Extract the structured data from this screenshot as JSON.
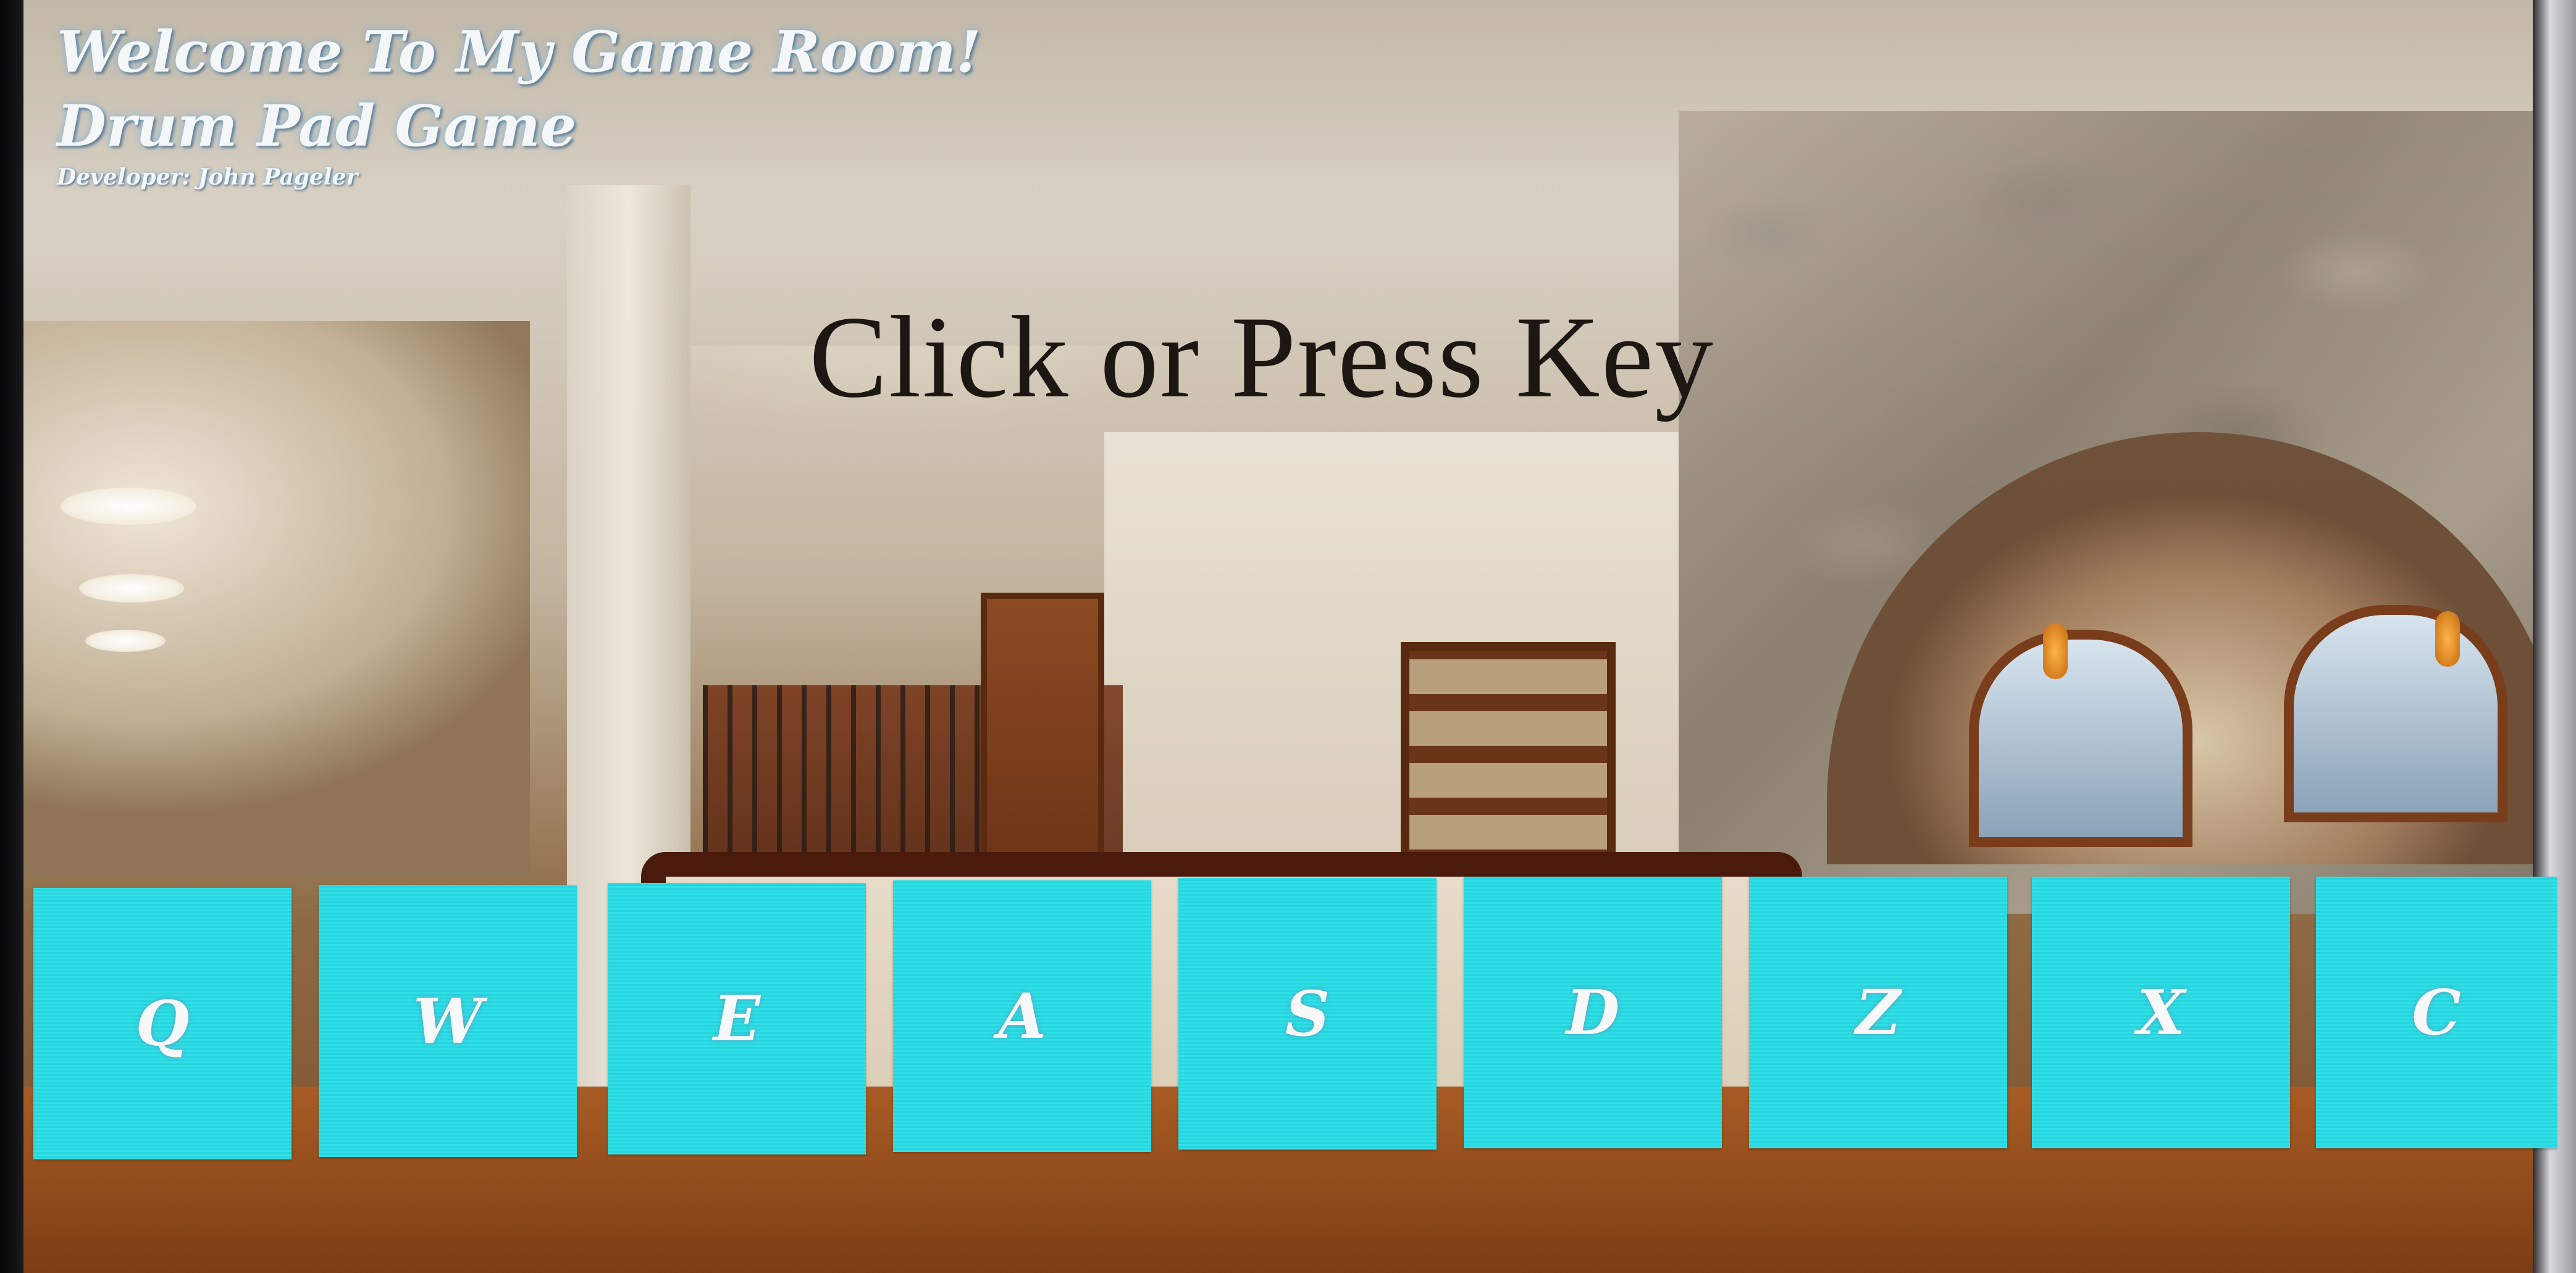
{
  "header": {
    "welcome_title": "Welcome To My Game Room!",
    "game_title": "Drum Pad Game",
    "developer": "Developer: John Pageler"
  },
  "display": {
    "text": "Click or Press Key"
  },
  "pads": [
    {
      "key": "Q"
    },
    {
      "key": "W"
    },
    {
      "key": "E"
    },
    {
      "key": "A"
    },
    {
      "key": "S"
    },
    {
      "key": "D"
    },
    {
      "key": "Z"
    },
    {
      "key": "X"
    },
    {
      "key": "C"
    }
  ],
  "colors": {
    "pad_background": "#27dde6",
    "pad_text": "#f6f8fa",
    "title_text": "#f4f6f8",
    "display_text": "#1c1712"
  }
}
